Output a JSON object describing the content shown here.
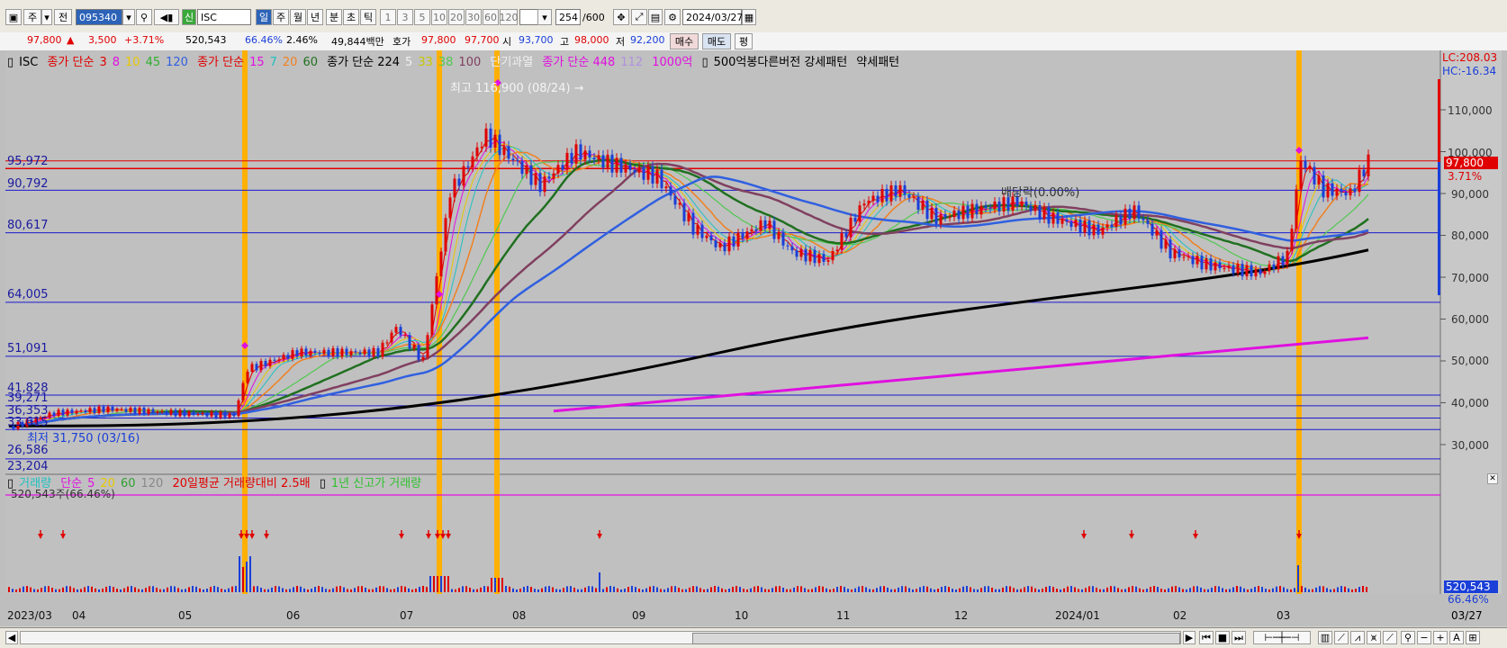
{
  "toolbar": {
    "mode_label": "주",
    "prev_label": "전",
    "code": "095340",
    "credit_badge": "신",
    "name": "ISC",
    "periods": [
      "일",
      "주",
      "월",
      "년",
      "분",
      "초",
      "틱"
    ],
    "intervals": [
      "1",
      "3",
      "5",
      "10",
      "20",
      "30",
      "60",
      "120"
    ],
    "count": "254",
    "count_total": "/600",
    "date": "2024/03/27"
  },
  "quote": {
    "price": "97,800",
    "arrow": "▲",
    "change": "3,500",
    "change_pct": "+3.71%",
    "volume": "520,543",
    "volume_pct": "66.46%",
    "turnover_pct": "2.46%",
    "amount": "49,844백만",
    "ask_label": "호가",
    "ask": "97,800",
    "bid": "97,700",
    "open_label": "시",
    "open": "93,700",
    "high_label": "고",
    "high": "98,000",
    "low_label": "저",
    "low": "92,200",
    "buy_label": "매수",
    "sell_label": "매도",
    "eval_label": "평"
  },
  "legend": {
    "name": "ISC",
    "ma1_label": "종가 단순",
    "ma1_values": [
      "3",
      "8",
      "10",
      "45",
      "120"
    ],
    "ma2_label": "종가 단순",
    "ma2_values": [
      "15",
      "7",
      "20",
      "60"
    ],
    "ma3_label": "종가 단순 224",
    "ma3_values": [
      "5",
      "33",
      "38",
      "100"
    ],
    "short_overheat": "단기과열",
    "ma4_label": "종가 단순 448",
    "ma4_value": "112",
    "big": "1000억",
    "pattern": "500억봉다른버전 강세패턴",
    "weak": "약세패턴"
  },
  "levels": [
    "95,972",
    "90,792",
    "80,617",
    "64,005",
    "51,091",
    "41,828",
    "39,271",
    "36,353",
    "33,615",
    "26,586",
    "23,204"
  ],
  "annotations": {
    "high": "최고 116,900 (08/24) →",
    "low": "최저 31,750 (03/16)",
    "dividend": "배당락(0.00%)"
  },
  "y_axis": [
    "110,000",
    "100,000",
    "90,000",
    "80,000",
    "70,000",
    "60,000",
    "50,000",
    "40,000",
    "30,000"
  ],
  "right_panel": {
    "lc": "LC:208.03",
    "hc": "HC:-16.34",
    "price_tag": "97,800",
    "pct_tag": "3.71%",
    "vol_tag": "520,543",
    "vol_pct_tag": "66.46%",
    "date_tag": "03/27"
  },
  "volume_legend": {
    "label": "거래량",
    "ma_label": "단순",
    "ma_values": [
      "5",
      "20",
      "60",
      "120"
    ],
    "ratio": "20일평균 거래량대비 2.5배",
    "new_high": "1년 신고가 거래량",
    "current": "520,543주(66.46%)"
  },
  "months": [
    "2023/03",
    "04",
    "05",
    "06",
    "07",
    "08",
    "09",
    "10",
    "11",
    "12",
    "2024/01",
    "02",
    "03"
  ],
  "colors": {
    "up": "#e00000",
    "down": "#1a3fd8",
    "ma_black": "#000000",
    "ma_magenta": "#e010e0",
    "highlight": "#ffb000"
  }
}
